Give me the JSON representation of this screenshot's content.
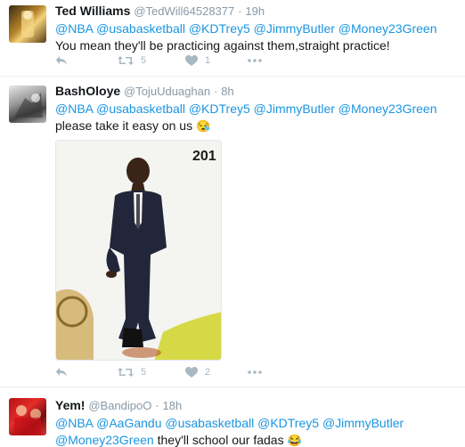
{
  "tweets": [
    {
      "name": "Ted Williams",
      "handle": "@TedWill64528377",
      "separator": "·",
      "time": "19h",
      "text_parts": [
        "@NBA",
        "@usabasketball",
        "@KDTrey5",
        "@JimmyButler",
        "@Money23Green",
        "You mean they'll be practicing against them,straight practice!"
      ],
      "retweets": "5",
      "likes": "1"
    },
    {
      "name": "BashOloye",
      "handle": "@TojuUduaghan",
      "separator": "·",
      "time": "8h",
      "text_parts": [
        "@NBA",
        "@usabasketball",
        "@KDTrey5",
        "@JimmyButler",
        "@Money23Green",
        "please take it easy on us",
        "😪"
      ],
      "media_text": "201",
      "media_bottom_text": "...",
      "retweets": "5",
      "likes": "2"
    },
    {
      "name": "Yem!",
      "handle": "@BandipoO",
      "separator": "·",
      "time": "18h",
      "text_parts": [
        "@NBA",
        "@AaGandu",
        "@usabasketball",
        "@KDTrey5",
        "@JimmyButler",
        "@Money23Green",
        "they'll school our fadas",
        "😂"
      ]
    }
  ],
  "colors": {
    "link": "#1b95e0",
    "meta": "#8899a6",
    "icon": "#aab8c2",
    "divider": "#e6ecf0"
  },
  "icons": [
    "reply-icon",
    "retweet-icon",
    "heart-icon",
    "more-icon"
  ]
}
